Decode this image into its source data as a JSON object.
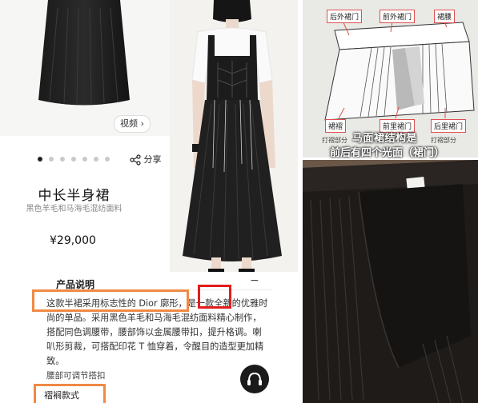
{
  "product": {
    "video_label": "视频",
    "share_label": "分享",
    "title": "中长半身裙",
    "subtitle": "黑色羊毛和马海毛混纺面料",
    "price": "¥29,000"
  },
  "description": {
    "header": "产品说明",
    "lines": [
      "这款半裙采用标志性的 Dior 廓形，是一款全新的优雅时",
      "尚的单品。采用黑色羊毛和马海毛混纺面料精心制作，",
      "搭配同色调腰带，腰部饰以金属腰带扣，提升格调。喇",
      "叭形剪裁，可搭配印花 T 恤穿着，令醒目的造型更加精",
      "致。"
    ],
    "waist_note": "腰部可调节搭扣",
    "cutwork_note": "褶裥款式"
  },
  "diagram": {
    "labels": {
      "back_outer_door": "后外裙门",
      "front_outer_door": "前外裙门",
      "waistband": "裙腰",
      "pleat": "裙褶",
      "front_inner_door": "前里裙门",
      "back_inner_door": "后里裙门",
      "pleat_part": "打褶部分",
      "pleat_part_2": "打褶部分"
    },
    "caption_line1": "马面裙结构是",
    "caption_line2": "前后有四个光面（裙门）"
  },
  "colors": {
    "highlight_orange": "#f08a45",
    "highlight_red": "#e31d1d",
    "fabric": "#1e1b19"
  }
}
